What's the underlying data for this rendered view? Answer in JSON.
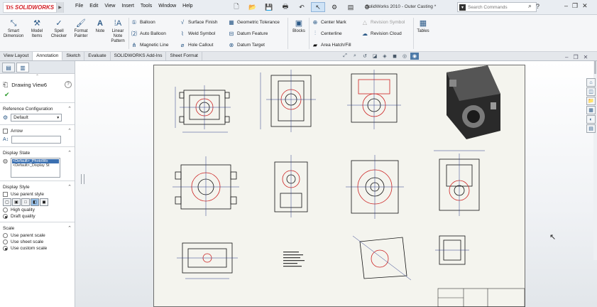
{
  "titlebar": {
    "logo": "SOLIDWORKS",
    "menu": [
      "File",
      "Edit",
      "View",
      "Insert",
      "Tools",
      "Window",
      "Help"
    ],
    "title": "SolidWorks 2010 - Outer Casting *",
    "search_placeholder": "Search Commands",
    "help": "?"
  },
  "ribbon": {
    "large_buttons": [
      {
        "label": "Smart\nDimension",
        "icon": "smart-dimension-icon"
      },
      {
        "label": "Model\nItems",
        "icon": "model-items-icon"
      },
      {
        "label": "Spell\nChecker",
        "icon": "spell-checker-icon"
      },
      {
        "label": "Format\nPainter",
        "icon": "format-painter-icon"
      },
      {
        "label": "Note",
        "icon": "note-icon"
      },
      {
        "label": "Linear\nNote\nPattern",
        "icon": "linear-note-pattern-icon"
      }
    ],
    "col1": [
      "Balloon",
      "Auto Balloon",
      "Magnetic Line"
    ],
    "col2": [
      "Surface Finish",
      "Weld Symbol",
      "Hole Callout"
    ],
    "col3": [
      "Geometric Tolerance",
      "Datum Feature",
      "Datum Target"
    ],
    "blocks": "Blocks",
    "col4": [
      "Center Mark",
      "Centerline",
      "Area Hatch/Fill"
    ],
    "col5": [
      "Revision Symbol",
      "Revision Cloud"
    ],
    "tables": "Tables"
  },
  "tabs": [
    "View Layout",
    "Annotation",
    "Sketch",
    "Evaluate",
    "SOLIDWORKS Add-Ins",
    "Sheet Format"
  ],
  "active_tab": "Annotation",
  "panel": {
    "title": "Drawing View6",
    "ref_config": {
      "heading": "Reference Configuration",
      "value": "Default"
    },
    "arrow": {
      "heading": "Arrow"
    },
    "display_state": {
      "heading": "Display State",
      "items": [
        "<Default>_PhotoWo",
        "<Default>_Display St"
      ]
    },
    "display_style": {
      "heading": "Display Style",
      "use_parent": "Use parent style",
      "quality": [
        "High quality",
        "Draft quality"
      ],
      "selected_quality": "Draft quality"
    },
    "scale": {
      "heading": "Scale",
      "options": [
        "Use parent scale",
        "Use sheet scale",
        "Use custom scale"
      ],
      "selected": "Use custom scale"
    }
  },
  "colors": {
    "accent": "#2c5a88",
    "brand": "#d32027",
    "sheet": "#f4f4ee",
    "drawing_red": "#cc2222",
    "drawing_blue": "#2b3a8a"
  }
}
